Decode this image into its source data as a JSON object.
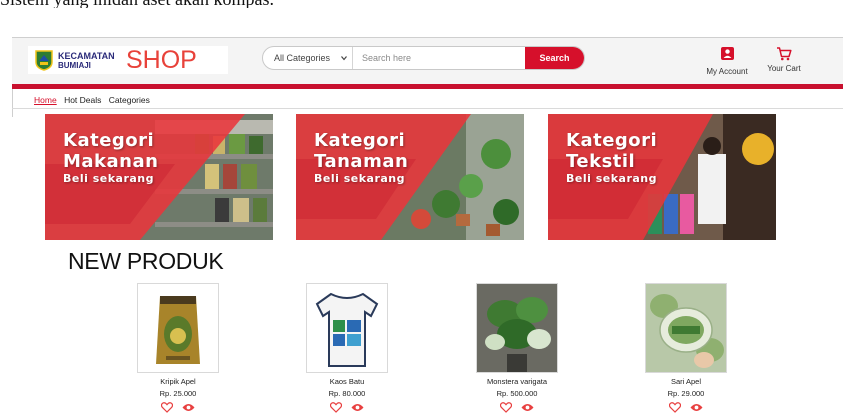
{
  "caption": "Sistem yang inidah aset akan kompas.",
  "header": {
    "logo": {
      "line1": "KECAMATAN",
      "line2": "BUMIAJI",
      "shop": "SHOP"
    },
    "search": {
      "category_selected": "All Categories",
      "placeholder": "Search here",
      "button_label": "Search"
    },
    "account_label": "My Account",
    "cart_label": "Your Cart",
    "accent_color": "#d6102b"
  },
  "nav": {
    "items": [
      {
        "label": "Home",
        "active": true
      },
      {
        "label": "Hot Deals",
        "active": false
      },
      {
        "label": "Categories",
        "active": false
      }
    ]
  },
  "banners": [
    {
      "line1": "Kategori",
      "line2": "Makanan",
      "line3": "Beli sekarang"
    },
    {
      "line1": "Kategori",
      "line2": "Tanaman",
      "line3": "Beli sekarang"
    },
    {
      "line1": "Kategori",
      "line2": "Tekstil",
      "line3": "Beli sekarang"
    }
  ],
  "section_title": "NEW PRODUK",
  "products": [
    {
      "name": "Kripik Apel",
      "price": "Rp. 25.000"
    },
    {
      "name": "Kaos Batu",
      "price": "Rp. 80.000"
    },
    {
      "name": "Monstera varigata",
      "price": "Rp. 500.000"
    },
    {
      "name": "Sari Apel",
      "price": "Rp. 29.000"
    }
  ],
  "icons": {
    "account": "account-icon",
    "cart": "cart-icon",
    "wishlist": "heart-icon",
    "view": "eye-icon"
  }
}
